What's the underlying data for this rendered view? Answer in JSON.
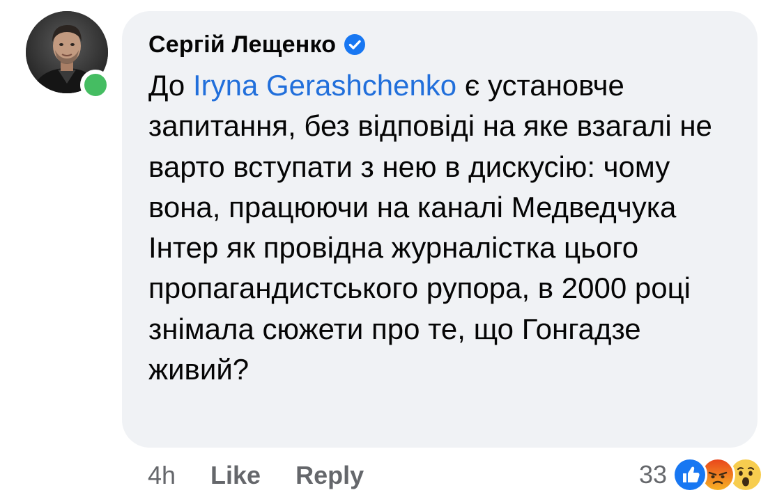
{
  "comment": {
    "author": "Сергій Лещенко",
    "verified": true,
    "text_prefix": "До ",
    "mention": "Iryna Gerashchenko",
    "text_body": " є установче запитання, без відповіді на яке взагалі не варто вступати з нею в дискусію: чому вона, працюючи на каналі Медведчука Інтер як провідна журналістка цього пропагандистського рупора, в 2000 році знімала сюжети про те, що Гонгадзе живий?"
  },
  "footer": {
    "time": "4h",
    "like_label": "Like",
    "reply_label": "Reply"
  },
  "reactions": {
    "count": "33",
    "types": [
      "like-reaction-icon",
      "angry-reaction-icon",
      "wow-reaction-icon"
    ]
  },
  "colors": {
    "bubble": "#f0f2f5",
    "mention": "#216fdb",
    "online": "#45bd62",
    "secondary_text": "#65676b",
    "like_blue": "#1877f2"
  }
}
